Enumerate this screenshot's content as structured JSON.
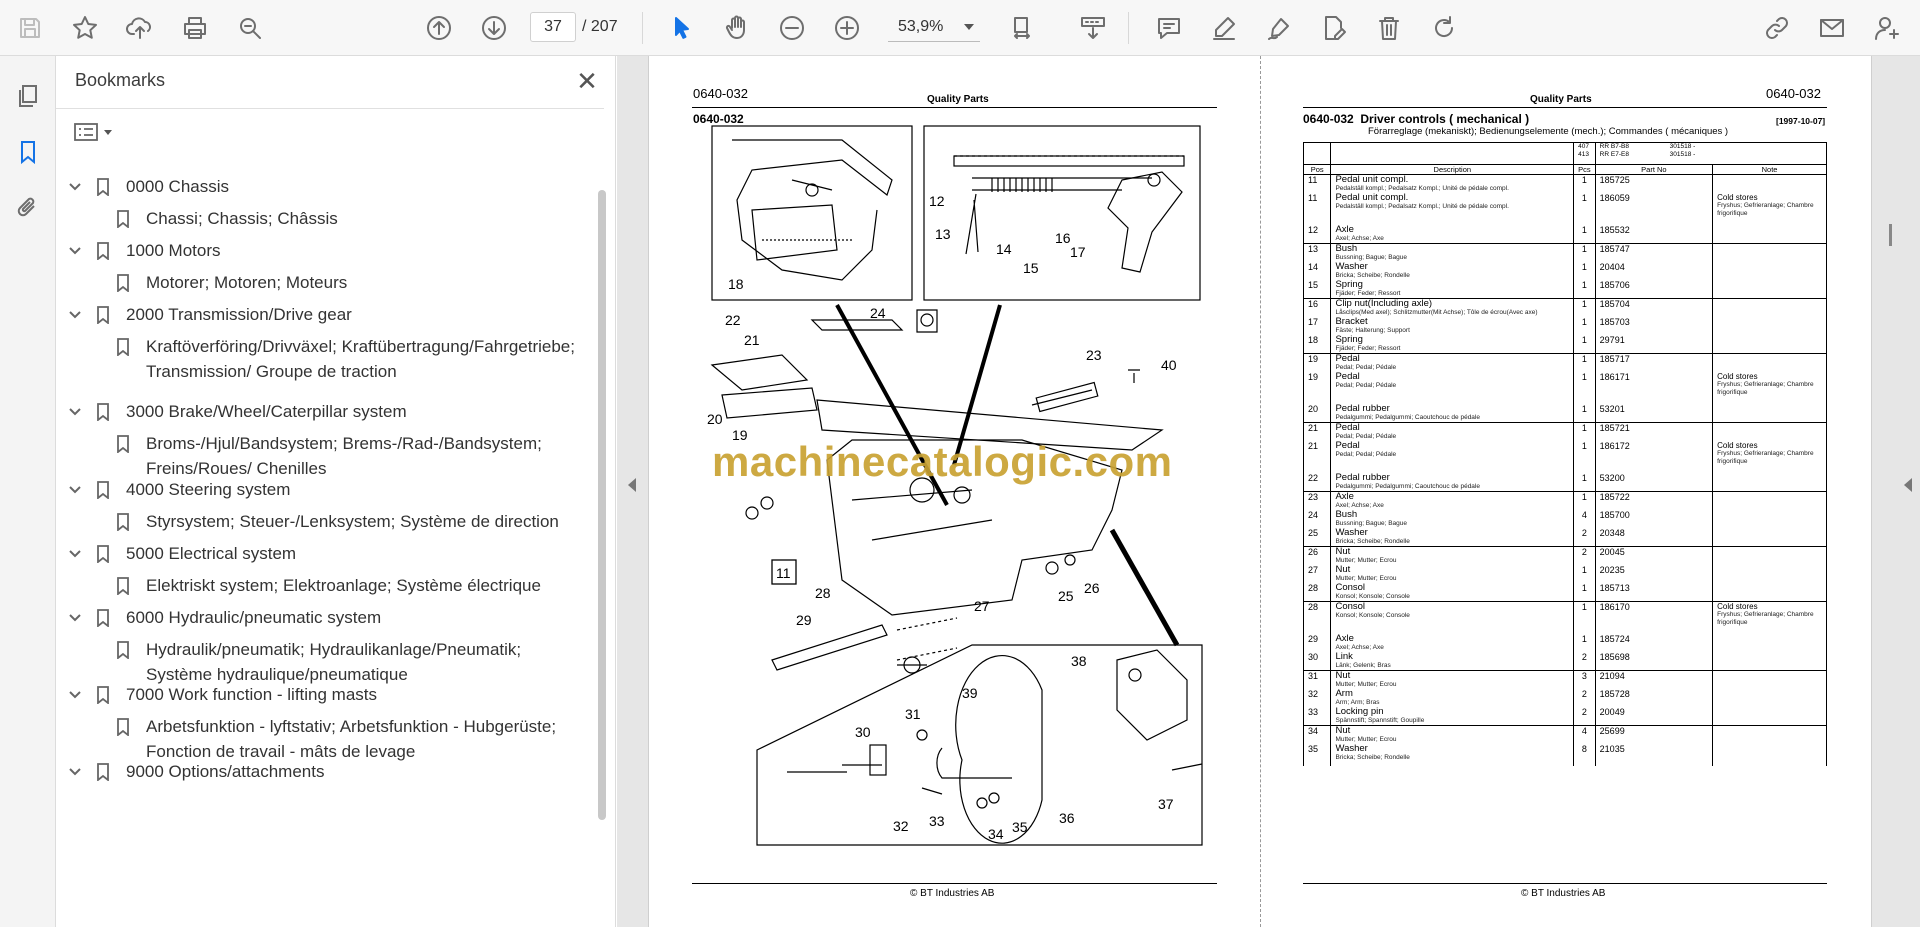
{
  "toolbar": {
    "page_current": "37",
    "page_total": "/  207",
    "zoom": "53,9%",
    "icons": [
      "save-icon",
      "star-icon",
      "upload-icon",
      "print-icon",
      "find-icon",
      "prev-page-icon",
      "next-page-icon",
      "select-tool-icon",
      "hand-tool-icon",
      "zoom-out-icon",
      "zoom-in-icon",
      "page-fit-icon",
      "scroll-mode-icon",
      "comment-icon",
      "highlight-icon",
      "sign-icon",
      "edit-pdf-icon",
      "delete-icon",
      "rotate-icon",
      "share-link-icon",
      "email-icon",
      "add-user-icon"
    ]
  },
  "sidebar": {
    "title": "Bookmarks",
    "close_label": "✕",
    "items": [
      {
        "label": "0000 Chassis",
        "level": 0
      },
      {
        "label": "Chassi; Chassis; Châssis",
        "level": 1
      },
      {
        "label": "1000 Motors",
        "level": 0
      },
      {
        "label": "Motorer; Motoren; Moteurs",
        "level": 1
      },
      {
        "label": "2000 Transmission/Drive gear",
        "level": 0
      },
      {
        "label": "Kraftöverföring/Drivväxel; Kraftübertragung/Fahrgetriebe; Transmission/ Groupe de traction",
        "level": 1
      },
      {
        "label": "3000 Brake/Wheel/Caterpillar system",
        "level": 0
      },
      {
        "label": "Broms-/Hjul/Bandsystem; Brems-/Rad-/Bandsystem; Freins/Roues/ Chenilles",
        "level": 1
      },
      {
        "label": "4000 Steering system",
        "level": 0
      },
      {
        "label": "Styrsystem; Steuer-/Lenksystem; Système de direction",
        "level": 1
      },
      {
        "label": "5000 Electrical system",
        "level": 0
      },
      {
        "label": "Elektriskt system; Elektroanlage; Système électrique",
        "level": 1
      },
      {
        "label": "6000 Hydraulic/pneumatic system",
        "level": 0
      },
      {
        "label": "Hydraulik/pneumatik; Hydraulikanlage/Pneumatik; Système hydraulique/pneumatique",
        "level": 1
      },
      {
        "label": "7000 Work function - lifting masts",
        "level": 0
      },
      {
        "label": "Arbetsfunktion - lyftstativ; Arbetsfunktion - Hubgerüste; Fonction de travail - mâts de levage",
        "level": 1
      },
      {
        "label": "9000 Options/attachments",
        "level": 0
      }
    ]
  },
  "left_page": {
    "code": "0640-032",
    "header": "Quality Parts",
    "code2": "0640-032",
    "copyright": "© BT Industries AB",
    "callouts": [
      "11",
      "12",
      "13",
      "14",
      "15",
      "16",
      "17",
      "18",
      "20",
      "19",
      "21",
      "22",
      "23",
      "24",
      "25",
      "26",
      "27",
      "28",
      "29",
      "30",
      "31",
      "32",
      "33",
      "34",
      "35",
      "36",
      "37",
      "38",
      "39",
      "40"
    ],
    "box_label": "11"
  },
  "watermark": "machinecatalogic.com",
  "right_page": {
    "code": "0640-032",
    "header": "Quality Parts",
    "section_code": "0640-032",
    "title": "Driver controls ( mechanical )",
    "subtitle": "Förarreglage (mekaniskt); Bedienungselemente (mech.); Commandes ( mécaniques )",
    "date": "[1997-10-07]",
    "models": [
      {
        "no": "407",
        "model": "RR B7-B8",
        "serial": "301518 -"
      },
      {
        "no": "413",
        "model": "RR E7-E8",
        "serial": "301518 -"
      }
    ],
    "columns": [
      "Pos",
      "Description",
      "Pcs",
      "Part No",
      "Note"
    ],
    "copyright": "© BT Industries AB",
    "groups": [
      [
        {
          "pos": "11",
          "desc": "Pedal unit compl.",
          "sub": "Pedalställ kompl.; Pedalsatz Kompl.; Unité de pédale compl.",
          "pcs": "1",
          "part": "185725",
          "note": ""
        },
        {
          "pos": "11",
          "desc": "Pedal unit compl.",
          "sub": "Pedalställ kompl.; Pedalsatz Kompl.; Unité de pédale compl.",
          "pcs": "1",
          "part": "186059",
          "note": "Cold stores",
          "note_sub": "Fryshus; Gefrieranlage; Chambre frigorifique"
        },
        {
          "pos": "12",
          "desc": "Axle",
          "sub": "Axel; Achse; Axe",
          "pcs": "1",
          "part": "185532",
          "note": ""
        }
      ],
      [
        {
          "pos": "13",
          "desc": "Bush",
          "sub": "Bussning; Bague; Bague",
          "pcs": "1",
          "part": "185747",
          "note": ""
        },
        {
          "pos": "14",
          "desc": "Washer",
          "sub": "Bricka; Scheibe; Rondelle",
          "pcs": "1",
          "part": "20404",
          "note": ""
        },
        {
          "pos": "15",
          "desc": "Spring",
          "sub": "Fjäder; Feder; Ressort",
          "pcs": "1",
          "part": "185706",
          "note": ""
        }
      ],
      [
        {
          "pos": "16",
          "desc": "Clip nut(Including axle)",
          "sub": "Låsclips(Med axel); Schlitzmutter(Mit Achse); Tôle de écrou(Avec axe)",
          "pcs": "1",
          "part": "185704",
          "note": ""
        },
        {
          "pos": "17",
          "desc": "Bracket",
          "sub": "Fäste; Halterung; Support",
          "pcs": "1",
          "part": "185703",
          "note": ""
        },
        {
          "pos": "18",
          "desc": "Spring",
          "sub": "Fjäder; Feder; Ressort",
          "pcs": "1",
          "part": "29791",
          "note": ""
        }
      ],
      [
        {
          "pos": "19",
          "desc": "Pedal",
          "sub": "Pedal; Pedal; Pédale",
          "pcs": "1",
          "part": "185717",
          "note": ""
        },
        {
          "pos": "19",
          "desc": "Pedal",
          "sub": "Pedal; Pedal; Pédale",
          "pcs": "1",
          "part": "186171",
          "note": "Cold stores",
          "note_sub": "Fryshus; Gefrieranlage; Chambre frigorifique"
        },
        {
          "pos": "20",
          "desc": "Pedal rubber",
          "sub": "Pedalgummi; Pedalgummi; Caoutchouc de pédale",
          "pcs": "1",
          "part": "53201",
          "note": ""
        }
      ],
      [
        {
          "pos": "21",
          "desc": "Pedal",
          "sub": "Pedal; Pedal; Pédale",
          "pcs": "1",
          "part": "185721",
          "note": ""
        },
        {
          "pos": "21",
          "desc": "Pedal",
          "sub": "Pedal; Pedal; Pédale",
          "pcs": "1",
          "part": "186172",
          "note": "Cold stores",
          "note_sub": "Fryshus; Gefrieranlage; Chambre frigorifique"
        },
        {
          "pos": "22",
          "desc": "Pedal rubber",
          "sub": "Pedalgummi; Pedalgummi; Caoutchouc de pédale",
          "pcs": "1",
          "part": "53200",
          "note": ""
        }
      ],
      [
        {
          "pos": "23",
          "desc": "Axle",
          "sub": "Axel; Achse; Axe",
          "pcs": "1",
          "part": "185722",
          "note": ""
        },
        {
          "pos": "24",
          "desc": "Bush",
          "sub": "Bussning; Bague; Bague",
          "pcs": "4",
          "part": "185700",
          "note": ""
        },
        {
          "pos": "25",
          "desc": "Washer",
          "sub": "Bricka; Scheibe; Rondelle",
          "pcs": "2",
          "part": "20348",
          "note": ""
        }
      ],
      [
        {
          "pos": "26",
          "desc": "Nut",
          "sub": "Mutter; Mutter; Ecrou",
          "pcs": "2",
          "part": "20045",
          "note": ""
        },
        {
          "pos": "27",
          "desc": "Nut",
          "sub": "Mutter; Mutter; Ecrou",
          "pcs": "1",
          "part": "20235",
          "note": ""
        },
        {
          "pos": "28",
          "desc": "Consol",
          "sub": "Konsol; Konsole; Console",
          "pcs": "1",
          "part": "185713",
          "note": ""
        }
      ],
      [
        {
          "pos": "28",
          "desc": "Consol",
          "sub": "Konsol; Konsole; Console",
          "pcs": "1",
          "part": "186170",
          "note": "Cold stores",
          "note_sub": "Fryshus; Gefrieranlage; Chambre frigorifique"
        },
        {
          "pos": "29",
          "desc": "Axle",
          "sub": "Axel; Achse; Axe",
          "pcs": "1",
          "part": "185724",
          "note": ""
        },
        {
          "pos": "30",
          "desc": "Link",
          "sub": "Länk; Gelenk; Bras",
          "pcs": "2",
          "part": "185698",
          "note": ""
        }
      ],
      [
        {
          "pos": "31",
          "desc": "Nut",
          "sub": "Mutter; Mutter; Ecrou",
          "pcs": "3",
          "part": "21094",
          "note": ""
        },
        {
          "pos": "32",
          "desc": "Arm",
          "sub": "Arm; Arm; Bras",
          "pcs": "2",
          "part": "185728",
          "note": ""
        },
        {
          "pos": "33",
          "desc": "Locking pin",
          "sub": "Spännstift; Spannstift; Goupille",
          "pcs": "2",
          "part": "20049",
          "note": ""
        }
      ],
      [
        {
          "pos": "34",
          "desc": "Nut",
          "sub": "Mutter; Mutter; Ecrou",
          "pcs": "4",
          "part": "25699",
          "note": ""
        },
        {
          "pos": "35",
          "desc": "Washer",
          "sub": "Bricka; Scheibe; Rondelle",
          "pcs": "8",
          "part": "21035",
          "note": ""
        }
      ]
    ]
  }
}
